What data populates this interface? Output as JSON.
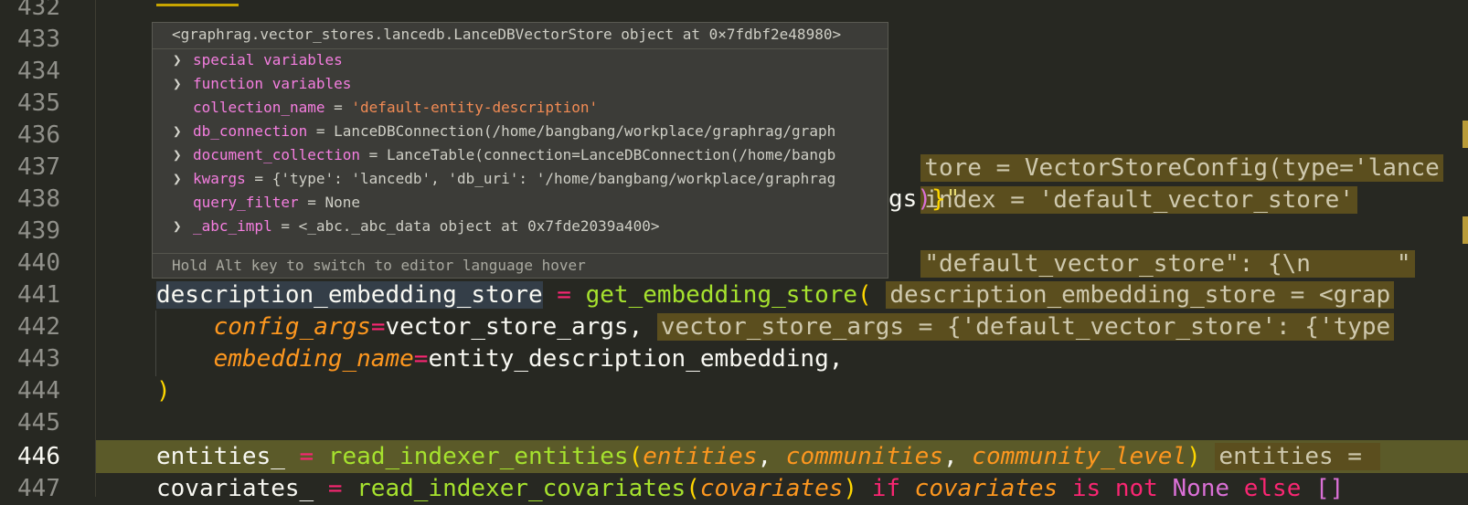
{
  "gutter": {
    "line_numbers": [
      "432",
      "433",
      "434",
      "435",
      "436",
      "437",
      "438",
      "439",
      "440",
      "441",
      "442",
      "443",
      "444",
      "445",
      "446",
      "447"
    ],
    "current_line": "446"
  },
  "hover": {
    "title": "<graphrag.vector_stores.lancedb.LanceDBVectorStore object at 0×7fdbf2e48980>",
    "rows": [
      {
        "expandable": true,
        "name": "special variables",
        "eq": "",
        "value": "",
        "value_is_string": false
      },
      {
        "expandable": true,
        "name": "function variables",
        "eq": "",
        "value": "",
        "value_is_string": false
      },
      {
        "expandable": false,
        "name": "collection_name",
        "eq": " = ",
        "value": "'default-entity-description'",
        "value_is_string": true
      },
      {
        "expandable": true,
        "name": "db_connection",
        "eq": " = ",
        "value": "LanceDBConnection(/home/bangbang/workplace/graphrag/graph",
        "value_is_string": false
      },
      {
        "expandable": true,
        "name": "document_collection",
        "eq": " = ",
        "value": "LanceTable(connection=LanceDBConnection(/home/bangb",
        "value_is_string": false
      },
      {
        "expandable": true,
        "name": "kwargs",
        "eq": " = ",
        "value": "{'type': 'lancedb', 'db_uri': '/home/bangbang/workplace/graphrag",
        "value_is_string": false
      },
      {
        "expandable": false,
        "name": "query_filter",
        "eq": " = ",
        "value": "None",
        "value_is_string": false
      },
      {
        "expandable": true,
        "name": "_abc_impl",
        "eq": " = ",
        "value": "<_abc._abc_data object at 0x7fde2039a400>",
        "value_is_string": false
      }
    ],
    "footer": "Hold Alt key to switch to editor language hover",
    "chevron_icon": "chevron-right-icon"
  },
  "code": {
    "l436_inlay": "tore = VectorStoreConfig(type='lance",
    "l437_inlay": "index = 'default_vector_store'",
    "l438_text": "gs",
    "l438_close": ")",
    "l438_brace": "}",
    "l438_quote": "\"",
    "l439_inlay": "\"default_vector_store\": {\\n      \"",
    "l441_var": "description_embedding_store",
    "l441_eq": " = ",
    "l441_fn": "get_embedding_store",
    "l441_paren": "(",
    "l441_inlay": "description_embedding_store = <grap",
    "l442_param": "config_args",
    "l442_eq": "=",
    "l442_val": "vector_store_args, ",
    "l442_inlay": "vector_store_args = {'default_vector_store': {'type",
    "l443_param": "embedding_name",
    "l443_eq": "=",
    "l443_val": "entity_description_embedding,",
    "l444_paren": ")",
    "l446_var": "entities_",
    "l446_eq": " = ",
    "l446_fn": "read_indexer_entities",
    "l446_open": "(",
    "l446_a1": "entities",
    "l446_c1": ", ",
    "l446_a2": "communities",
    "l446_c2": ", ",
    "l446_a3": "community_level",
    "l446_close": ")",
    "l446_inlay": "entities = ",
    "l447_var": "covariates_",
    "l447_eq": " = ",
    "l447_fn": "read_indexer_covariates",
    "l447_open": "(",
    "l447_a1": "covariates",
    "l447_close": ")",
    "l447_kw1": " if ",
    "l447_a2": "covariates",
    "l447_kw2": " is not ",
    "l447_none": "None",
    "l447_kw3": " else ",
    "l447_list": "[]"
  },
  "colors": {
    "background": "#272822",
    "current_line_highlight": "#5b5a29",
    "keyword": "#f92672",
    "function": "#a6e22e",
    "parameter": "#fd971f",
    "string": "#e6db74"
  }
}
